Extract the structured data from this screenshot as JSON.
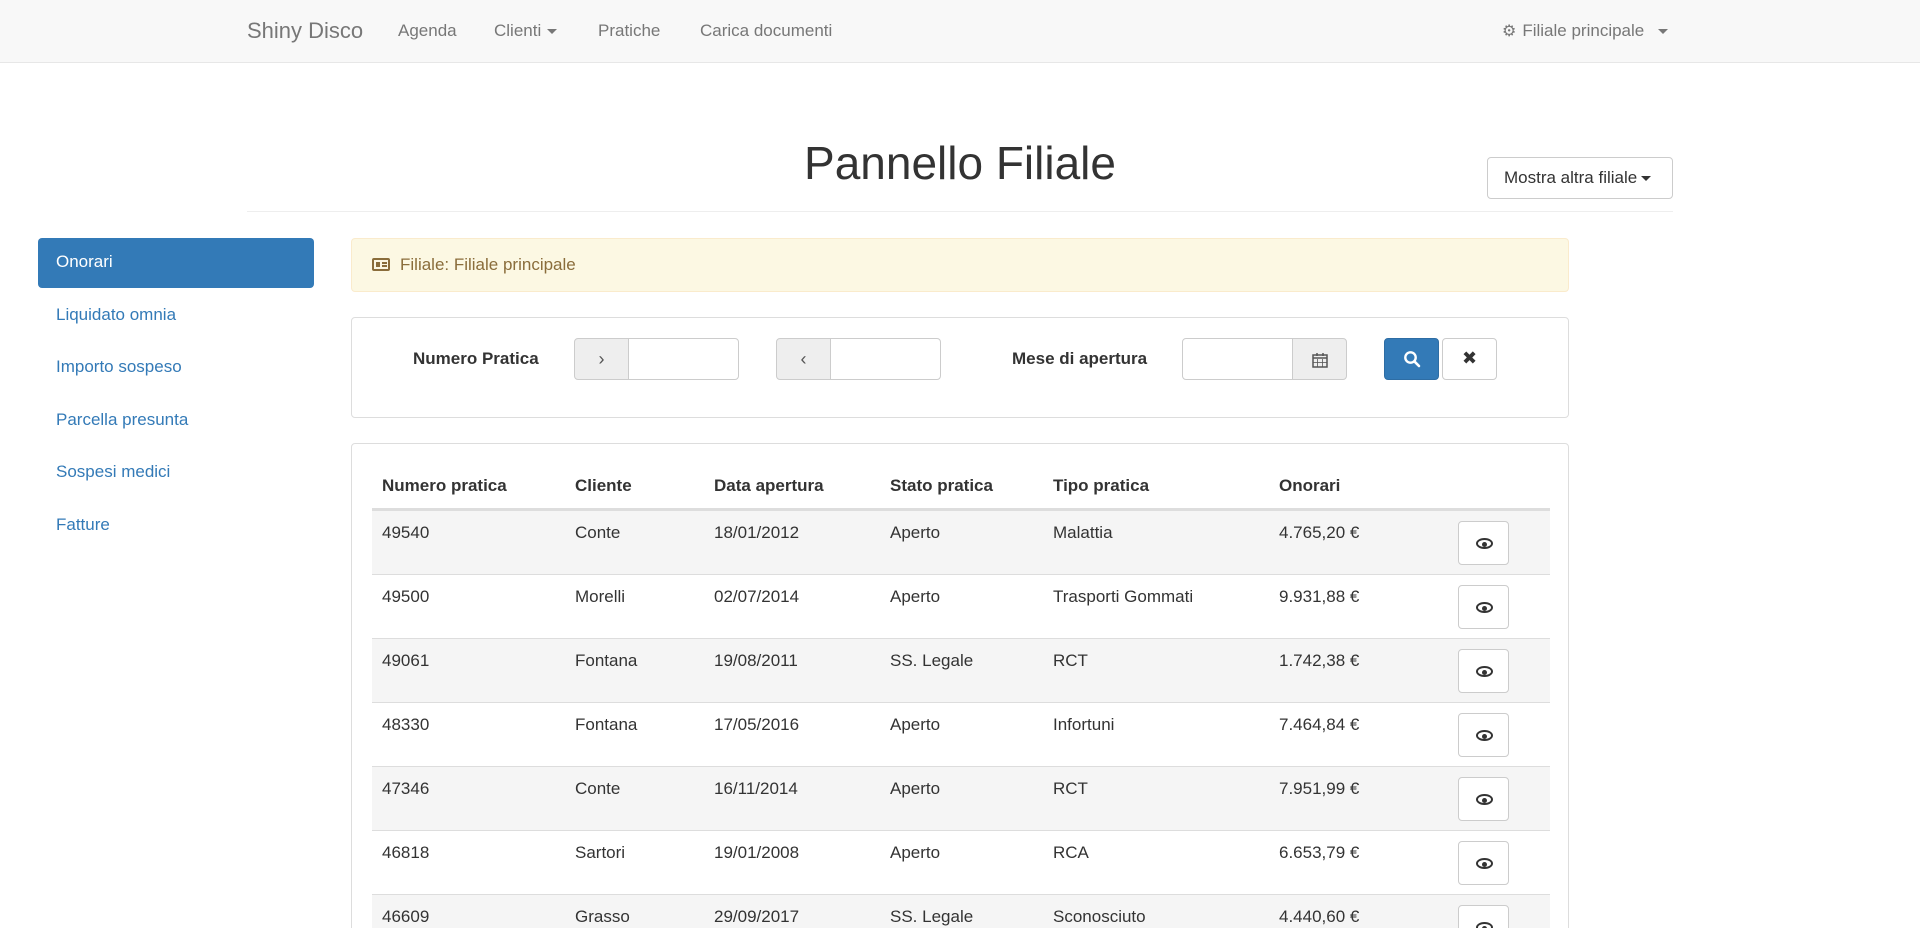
{
  "navbar": {
    "brand": "Shiny Disco",
    "links": [
      "Agenda",
      "Clienti",
      "Pratiche",
      "Carica documenti"
    ],
    "branch_menu": "Filiale principale"
  },
  "header": {
    "title": "Pannello Filiale",
    "branch_button": "Mostra altra filiale"
  },
  "sidebar": {
    "items": [
      {
        "label": "Onorari",
        "active": true
      },
      {
        "label": "Liquidato omnia",
        "active": false
      },
      {
        "label": "Importo sospeso",
        "active": false
      },
      {
        "label": "Parcella presunta",
        "active": false
      },
      {
        "label": "Sospesi medici",
        "active": false
      },
      {
        "label": "Fatture",
        "active": false
      }
    ]
  },
  "alert": {
    "text": "Filiale: Filiale principale"
  },
  "filters": {
    "numero_pratica_label": "Numero Pratica",
    "greater_symbol": "›",
    "less_symbol": "‹",
    "greater_value": "",
    "less_value": "",
    "mese_label": "Mese di apertura",
    "mese_value": ""
  },
  "table": {
    "columns": [
      "Numero pratica",
      "Cliente",
      "Data apertura",
      "Stato pratica",
      "Tipo pratica",
      "Onorari"
    ],
    "rows": [
      [
        "49540",
        "Conte",
        "18/01/2012",
        "Aperto",
        "Malattia",
        "4.765,20 €"
      ],
      [
        "49500",
        "Morelli",
        "02/07/2014",
        "Aperto",
        "Trasporti Gommati",
        "9.931,88 €"
      ],
      [
        "49061",
        "Fontana",
        "19/08/2011",
        "SS. Legale",
        "RCT",
        "1.742,38 €"
      ],
      [
        "48330",
        "Fontana",
        "17/05/2016",
        "Aperto",
        "Infortuni",
        "7.464,84 €"
      ],
      [
        "47346",
        "Conte",
        "16/11/2014",
        "Aperto",
        "RCT",
        "7.951,99 €"
      ],
      [
        "46818",
        "Sartori",
        "19/01/2008",
        "Aperto",
        "RCA",
        "6.653,79 €"
      ],
      [
        "46609",
        "Grasso",
        "29/09/2017",
        "SS. Legale",
        "Sconosciuto",
        "4.440,60 €"
      ]
    ]
  },
  "colors": {
    "primary": "#337ab7",
    "navbar_bg": "#f8f8f8",
    "alert_bg": "#fcf8e3",
    "alert_text": "#8a6d3b"
  }
}
